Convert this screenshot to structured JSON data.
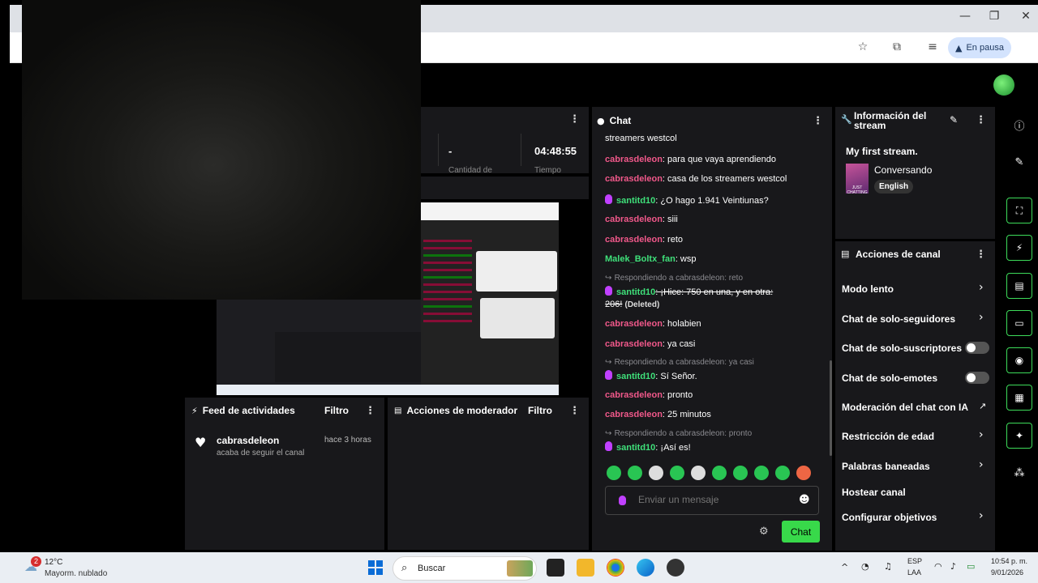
{
  "browser": {
    "pause_label": "En pausa",
    "window_controls": [
      "—",
      "❐",
      "✕"
    ]
  },
  "stats": {
    "value1": "-",
    "value2": "04:48:55",
    "label1": "Cantidad de",
    "label2": "Tiempo"
  },
  "activity_feed": {
    "title": "Feed de actividades",
    "filter": "Filtro",
    "item": {
      "user": "cabrasdeleon",
      "time": "hace 3 horas",
      "text": "acaba de seguir el canal"
    }
  },
  "mod_actions": {
    "title": "Acciones de moderador",
    "filter": "Filtro"
  },
  "chat": {
    "title": "Chat",
    "top_fragment": "streamers westcol",
    "messages": [
      {
        "user": "cabrasdeleon",
        "text": ": para que vaya aprendiendo"
      },
      {
        "user": "cabrasdeleon",
        "text": ": casa de los streamers westcol"
      },
      {
        "user": "santitd10",
        "text": ": ¿O hago 1.941 Veintiunas?"
      },
      {
        "user": "cabrasdeleon",
        "text": ": siii"
      },
      {
        "user": "cabrasdeleon",
        "text": ": reto"
      },
      {
        "user": "Malek_Boltx_fan",
        "text": ": wsp"
      },
      {
        "reply": "Respondiendo a cabrasdeleon: reto"
      },
      {
        "user": "santitd10",
        "text": ": ¡Hice: 750 en una, y en otra:"
      },
      {
        "continuation": "206!",
        "deleted": "(Deleted)"
      },
      {
        "user": "cabrasdeleon",
        "text": ": holabien"
      },
      {
        "user": "cabrasdeleon",
        "text": ": ya casi"
      },
      {
        "reply": "Respondiendo a cabrasdeleon: ya casi"
      },
      {
        "user": "santitd10",
        "text": ": Sí Señor."
      },
      {
        "user": "cabrasdeleon",
        "text": ": pronto"
      },
      {
        "user": "cabrasdeleon",
        "text": ": 25 minutos"
      },
      {
        "reply": "Respondiendo a cabrasdeleon: pronto"
      },
      {
        "user": "santitd10",
        "text": ": ¡Así es!"
      }
    ],
    "input_placeholder": "Enviar un mensaje",
    "send_label": "Chat"
  },
  "stream_info": {
    "title_line1": "Información del",
    "title_line2": "stream",
    "stream_title": "My first stream.",
    "category": "Conversando",
    "tag": "English",
    "thumb_label": "JUST CHATTING"
  },
  "channel_actions": {
    "title": "Acciones de canal",
    "items": [
      {
        "label": "Modo lento",
        "control": "chevron"
      },
      {
        "label": "Chat de solo-seguidores",
        "control": "chevron"
      },
      {
        "label": "Chat de solo-suscriptores",
        "control": "toggle"
      },
      {
        "label": "Chat de solo-emotes",
        "control": "toggle"
      },
      {
        "label": "Moderación del chat con IA",
        "control": "chart"
      },
      {
        "label": "Restricción de edad",
        "control": "chevron"
      },
      {
        "label": "Palabras baneadas",
        "control": "chevron"
      },
      {
        "label": "Hostear canal",
        "control": "none"
      },
      {
        "label": "Configurar objetivos",
        "control": "chevron"
      }
    ]
  },
  "taskbar": {
    "weather_temp": "12°C",
    "weather_desc": "Mayorm. nublado",
    "weather_badge": "2",
    "search_label": "Buscar",
    "lang1": "ESP",
    "lang2": "LAA",
    "time": "10:54 p. m.",
    "date": "9/01/2026"
  },
  "colors": {
    "accent_green": "#38d94a",
    "username_pink": "#f0588a",
    "username_green": "#3fe07a",
    "panel_bg": "#18181b"
  }
}
